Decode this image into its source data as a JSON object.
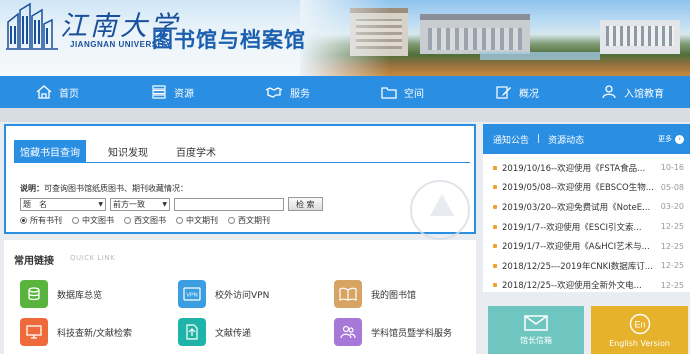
{
  "header": {
    "univ_name_cn": "江南大学",
    "univ_name_en": "JIANGNAN UNIVERSITY",
    "library_name": "图书馆与档案馆"
  },
  "nav": {
    "items": [
      {
        "label": "首页",
        "icon": "home-icon"
      },
      {
        "label": "资源",
        "icon": "database-icon"
      },
      {
        "label": "服务",
        "icon": "handshake-icon"
      },
      {
        "label": "空间",
        "icon": "folder-icon"
      },
      {
        "label": "概况",
        "icon": "edit-icon"
      },
      {
        "label": "入馆教育",
        "icon": "person-icon"
      }
    ]
  },
  "search": {
    "tabs": [
      "馆藏书目查询",
      "知识发现",
      "百度学术"
    ],
    "active_tab": 0,
    "desc_label": "说明：",
    "desc_text": "可查询图书馆纸质图书、期刊收藏情况：",
    "field_select": "题　名",
    "match_select": "前方一致",
    "query_value": "",
    "search_button": "检 索",
    "radios": [
      "所有书刊",
      "中文图书",
      "西文图书",
      "中文期刊",
      "西文期刊"
    ],
    "radio_selected": 0
  },
  "quick_links": {
    "title": "常用链接",
    "subtitle": "QUICK LINK",
    "items": [
      {
        "label": "数据库总览",
        "icon": "database-stack-icon",
        "color": "#58b43c"
      },
      {
        "label": "校外访问VPN",
        "icon": "vpn-icon",
        "color": "#3a9ee0"
      },
      {
        "label": "我的图书馆",
        "icon": "book-icon",
        "color": "#d7a464"
      },
      {
        "label": "科技查新/文献检索",
        "icon": "monitor-icon",
        "color": "#ee6a3a"
      },
      {
        "label": "文献传递",
        "icon": "document-transfer-icon",
        "color": "#1fb4a8"
      },
      {
        "label": "学科馆员暨学科服务",
        "icon": "people-icon",
        "color": "#a678d8"
      }
    ]
  },
  "notices": {
    "tab_active": "通知公告",
    "tab_other": "资源动态",
    "more_label": "更多",
    "items": [
      {
        "title": "2019/10/16--欢迎使用《FSTA食品...",
        "date": "10-16"
      },
      {
        "title": "2019/05/08--欢迎使用《EBSCO生物...",
        "date": "05-08"
      },
      {
        "title": "2019/03/20--欢迎免费试用《NoteE...",
        "date": "03-20"
      },
      {
        "title": "2019/1/7--欢迎使用《ESCI引文索...",
        "date": "12-25"
      },
      {
        "title": "2019/1/7--欢迎使用《A&HCI艺术与...",
        "date": "12-25"
      },
      {
        "title": "2018/12/25---2019年CNKI数据库订...",
        "date": "12-25"
      },
      {
        "title": "2018/12/25--欢迎使用全新外文电...",
        "date": "12-25"
      }
    ]
  },
  "tiles": [
    {
      "label": "馆长信箱",
      "icon": "mail-icon",
      "color": "#6fc6c0"
    },
    {
      "label": "English Version",
      "icon": "english-icon",
      "color": "#e6b22c"
    }
  ],
  "colors": {
    "primary": "#2a8ee3",
    "bullet": "#f0a030"
  }
}
